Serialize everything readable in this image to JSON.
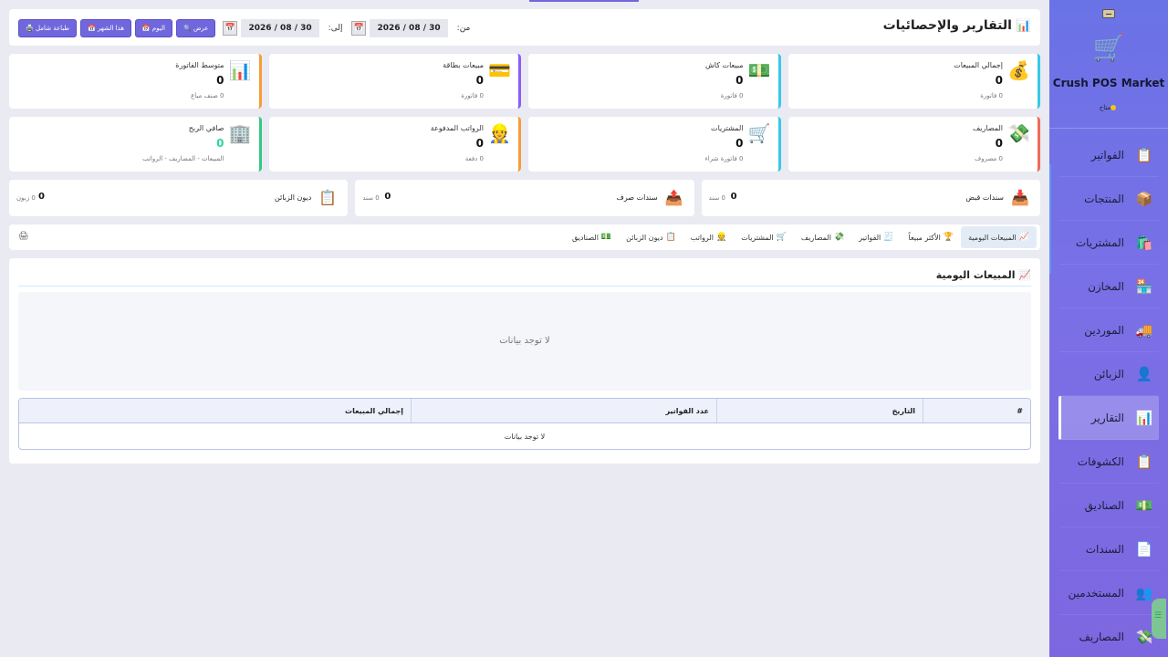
{
  "sidebar": {
    "brand": "Crush POS Market",
    "status": "متاح",
    "items": [
      {
        "label": "الفواتير",
        "icon": "📋"
      },
      {
        "label": "المنتجات",
        "icon": "📦"
      },
      {
        "label": "المشتريات",
        "icon": "🛍️"
      },
      {
        "label": "المخازن",
        "icon": "🏪"
      },
      {
        "label": "الموردين",
        "icon": "🚚"
      },
      {
        "label": "الزبائن",
        "icon": "👤"
      },
      {
        "label": "التقارير",
        "icon": "📊"
      },
      {
        "label": "الكشوفات",
        "icon": "📋"
      },
      {
        "label": "الصناديق",
        "icon": "💵"
      },
      {
        "label": "السندات",
        "icon": "📄"
      },
      {
        "label": "المستخدمين",
        "icon": "👥"
      },
      {
        "label": "المصاريف",
        "icon": "💸"
      }
    ]
  },
  "header": {
    "title": "التقارير والإحصائيات",
    "from_label": "من:",
    "to_label": "إلى:",
    "from_date": "2026 / 08 / 30",
    "to_date": "2026 / 08 / 30",
    "btn_view": "🔍 عرض",
    "btn_today": "📅 اليوم",
    "btn_month": "📅 هذا الشهر",
    "btn_print": "🖨️ طباعة شامل"
  },
  "stats_row1": [
    {
      "title": "إجمالي المبيعات",
      "value": "0",
      "sub": "0 فاتورة",
      "icon": "💰"
    },
    {
      "title": "مبيعات كاش",
      "value": "0",
      "sub": "0 فاتورة",
      "icon": "💵"
    },
    {
      "title": "مبيعات بطاقة",
      "value": "0",
      "sub": "0 فاتورة",
      "icon": "💳"
    },
    {
      "title": "متوسط الفاتورة",
      "value": "0",
      "sub": "0 صنف مباع",
      "icon": "📊"
    }
  ],
  "stats_row2": [
    {
      "title": "المصاريف",
      "value": "0",
      "sub": "0 مصروف",
      "icon": "💸"
    },
    {
      "title": "المشتريات",
      "value": "0",
      "sub": "0 فاتورة شراء",
      "icon": "🛒"
    },
    {
      "title": "الرواتب المدفوعة",
      "value": "0",
      "sub": "0 دفعة",
      "icon": "👷"
    },
    {
      "title": "صافي الربح",
      "value": "0",
      "sub": "المبيعات - المصاريف - الرواتب",
      "icon": "🏢"
    }
  ],
  "small_stats": [
    {
      "title": "سندات قبض",
      "value": "0",
      "unit": "0 سند",
      "icon": "📥"
    },
    {
      "title": "سندات صرف",
      "value": "0",
      "unit": "0 سند",
      "icon": "📤"
    },
    {
      "title": "ديون الزبائن",
      "value": "0",
      "unit": "0 زبون",
      "icon": "📋"
    }
  ],
  "tabs": [
    {
      "label": "المبيعات اليومية",
      "icon": "📈"
    },
    {
      "label": "الأكثر مبيعاً",
      "icon": "🏆"
    },
    {
      "label": "الفواتير",
      "icon": "🧾"
    },
    {
      "label": "المصاريف",
      "icon": "💸"
    },
    {
      "label": "المشتريات",
      "icon": "🛒"
    },
    {
      "label": "الرواتب",
      "icon": "👷"
    },
    {
      "label": "ديون الزبائن",
      "icon": "📋"
    },
    {
      "label": "الصناديق",
      "icon": "💵"
    }
  ],
  "print_icon": "🖨",
  "report": {
    "title": "📈 المبيعات اليومية",
    "no_data": "لا توجد بيانات",
    "columns": [
      "#",
      "التاريخ",
      "عدد الفواتير",
      "إجمالي المبيعات"
    ],
    "table_empty": "لا توجد بيانات"
  }
}
